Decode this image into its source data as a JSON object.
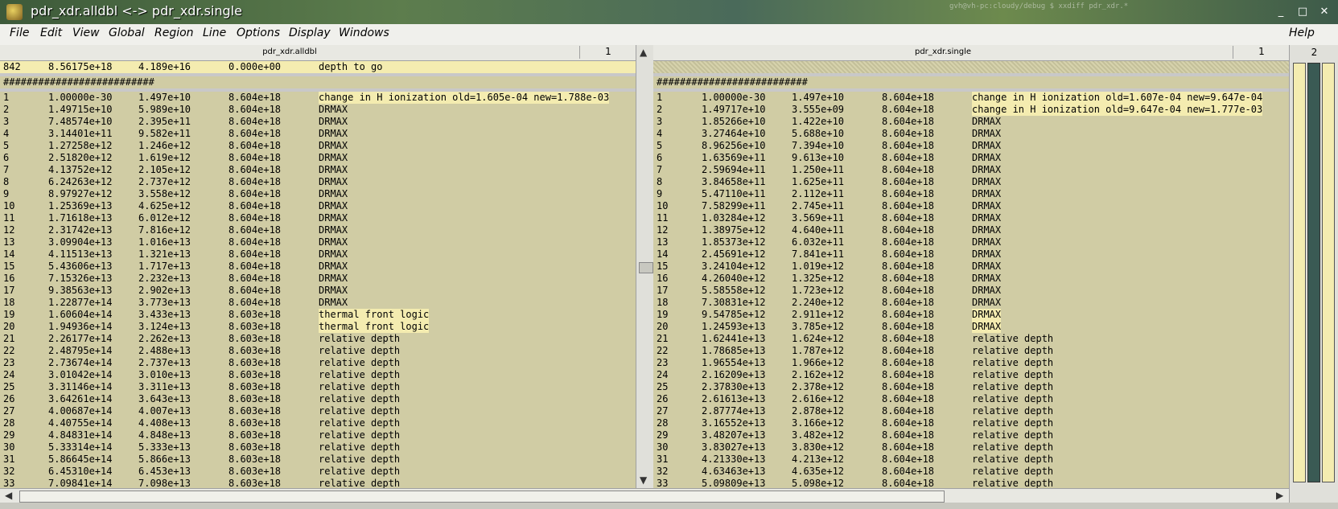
{
  "window": {
    "title": "pdr_xdr.alldbl <-> pdr_xdr.single",
    "bg_hint": "gvh@vh-pc:cloudy/debug $ xxdiff pdr_xdr.*",
    "minimize": "_",
    "maximize": "□",
    "close": "✕"
  },
  "menu": {
    "items": [
      "File",
      "Edit",
      "View",
      "Global",
      "Region",
      "Line",
      "Options",
      "Display",
      "Windows"
    ],
    "help": "Help"
  },
  "left": {
    "filename": "pdr_xdr.alldbl",
    "line": "1",
    "first": [
      "842",
      "8.56175e+18",
      "4.189e+16",
      "0.000e+00",
      "depth to go"
    ],
    "hashes": "##########################",
    "rows": [
      [
        "1",
        "1.00000e-30",
        "1.497e+10",
        "8.604e+18",
        "change in H ionization old=1.605e-04 new=1.788e-03"
      ],
      [
        "2",
        "1.49715e+10",
        "5.989e+10",
        "8.604e+18",
        "DRMAX"
      ],
      [
        "3",
        "7.48574e+10",
        "2.395e+11",
        "8.604e+18",
        "DRMAX"
      ],
      [
        "4",
        "3.14401e+11",
        "9.582e+11",
        "8.604e+18",
        "DRMAX"
      ],
      [
        "5",
        "1.27258e+12",
        "1.246e+12",
        "8.604e+18",
        "DRMAX"
      ],
      [
        "6",
        "2.51820e+12",
        "1.619e+12",
        "8.604e+18",
        "DRMAX"
      ],
      [
        "7",
        "4.13752e+12",
        "2.105e+12",
        "8.604e+18",
        "DRMAX"
      ],
      [
        "8",
        "6.24263e+12",
        "2.737e+12",
        "8.604e+18",
        "DRMAX"
      ],
      [
        "9",
        "8.97927e+12",
        "3.558e+12",
        "8.604e+18",
        "DRMAX"
      ],
      [
        "10",
        "1.25369e+13",
        "4.625e+12",
        "8.604e+18",
        "DRMAX"
      ],
      [
        "11",
        "1.71618e+13",
        "6.012e+12",
        "8.604e+18",
        "DRMAX"
      ],
      [
        "12",
        "2.31742e+13",
        "7.816e+12",
        "8.604e+18",
        "DRMAX"
      ],
      [
        "13",
        "3.09904e+13",
        "1.016e+13",
        "8.604e+18",
        "DRMAX"
      ],
      [
        "14",
        "4.11513e+13",
        "1.321e+13",
        "8.604e+18",
        "DRMAX"
      ],
      [
        "15",
        "5.43606e+13",
        "1.717e+13",
        "8.604e+18",
        "DRMAX"
      ],
      [
        "16",
        "7.15326e+13",
        "2.232e+13",
        "8.604e+18",
        "DRMAX"
      ],
      [
        "17",
        "9.38563e+13",
        "2.902e+13",
        "8.604e+18",
        "DRMAX"
      ],
      [
        "18",
        "1.22877e+14",
        "3.773e+13",
        "8.604e+18",
        "DRMAX"
      ],
      [
        "19",
        "1.60604e+14",
        "3.433e+13",
        "8.603e+18",
        "thermal front logic"
      ],
      [
        "20",
        "1.94936e+14",
        "3.124e+13",
        "8.603e+18",
        "thermal front logic"
      ],
      [
        "21",
        "2.26177e+14",
        "2.262e+13",
        "8.603e+18",
        "relative depth"
      ],
      [
        "22",
        "2.48795e+14",
        "2.488e+13",
        "8.603e+18",
        "relative depth"
      ],
      [
        "23",
        "2.73674e+14",
        "2.737e+13",
        "8.603e+18",
        "relative depth"
      ],
      [
        "24",
        "3.01042e+14",
        "3.010e+13",
        "8.603e+18",
        "relative depth"
      ],
      [
        "25",
        "3.31146e+14",
        "3.311e+13",
        "8.603e+18",
        "relative depth"
      ],
      [
        "26",
        "3.64261e+14",
        "3.643e+13",
        "8.603e+18",
        "relative depth"
      ],
      [
        "27",
        "4.00687e+14",
        "4.007e+13",
        "8.603e+18",
        "relative depth"
      ],
      [
        "28",
        "4.40755e+14",
        "4.408e+13",
        "8.603e+18",
        "relative depth"
      ],
      [
        "29",
        "4.84831e+14",
        "4.848e+13",
        "8.603e+18",
        "relative depth"
      ],
      [
        "30",
        "5.33314e+14",
        "5.333e+13",
        "8.603e+18",
        "relative depth"
      ],
      [
        "31",
        "5.86645e+14",
        "5.866e+13",
        "8.603e+18",
        "relative depth"
      ],
      [
        "32",
        "6.45310e+14",
        "6.453e+13",
        "8.603e+18",
        "relative depth"
      ],
      [
        "33",
        "7.09841e+14",
        "7.098e+13",
        "8.603e+18",
        "relative depth"
      ]
    ]
  },
  "right": {
    "filename": "pdr_xdr.single",
    "line": "1",
    "hashes": "##########################",
    "rows": [
      [
        "1",
        "1.00000e-30",
        "1.497e+10",
        "8.604e+18",
        "change in H ionization old=1.607e-04 new=9.647e-04"
      ],
      [
        "2",
        "1.49717e+10",
        "3.555e+09",
        "8.604e+18",
        "change in H ionization old=9.647e-04 new=1.777e-03"
      ],
      [
        "3",
        "1.85266e+10",
        "1.422e+10",
        "8.604e+18",
        "DRMAX"
      ],
      [
        "4",
        "3.27464e+10",
        "5.688e+10",
        "8.604e+18",
        "DRMAX"
      ],
      [
        "5",
        "8.96256e+10",
        "7.394e+10",
        "8.604e+18",
        "DRMAX"
      ],
      [
        "6",
        "1.63569e+11",
        "9.613e+10",
        "8.604e+18",
        "DRMAX"
      ],
      [
        "7",
        "2.59694e+11",
        "1.250e+11",
        "8.604e+18",
        "DRMAX"
      ],
      [
        "8",
        "3.84658e+11",
        "1.625e+11",
        "8.604e+18",
        "DRMAX"
      ],
      [
        "9",
        "5.47110e+11",
        "2.112e+11",
        "8.604e+18",
        "DRMAX"
      ],
      [
        "10",
        "7.58299e+11",
        "2.745e+11",
        "8.604e+18",
        "DRMAX"
      ],
      [
        "11",
        "1.03284e+12",
        "3.569e+11",
        "8.604e+18",
        "DRMAX"
      ],
      [
        "12",
        "1.38975e+12",
        "4.640e+11",
        "8.604e+18",
        "DRMAX"
      ],
      [
        "13",
        "1.85373e+12",
        "6.032e+11",
        "8.604e+18",
        "DRMAX"
      ],
      [
        "14",
        "2.45691e+12",
        "7.841e+11",
        "8.604e+18",
        "DRMAX"
      ],
      [
        "15",
        "3.24104e+12",
        "1.019e+12",
        "8.604e+18",
        "DRMAX"
      ],
      [
        "16",
        "4.26040e+12",
        "1.325e+12",
        "8.604e+18",
        "DRMAX"
      ],
      [
        "17",
        "5.58558e+12",
        "1.723e+12",
        "8.604e+18",
        "DRMAX"
      ],
      [
        "18",
        "7.30831e+12",
        "2.240e+12",
        "8.604e+18",
        "DRMAX"
      ],
      [
        "19",
        "9.54785e+12",
        "2.911e+12",
        "8.604e+18",
        "DRMAX"
      ],
      [
        "20",
        "1.24593e+13",
        "3.785e+12",
        "8.604e+18",
        "DRMAX"
      ],
      [
        "21",
        "1.62441e+13",
        "1.624e+12",
        "8.604e+18",
        "relative depth"
      ],
      [
        "22",
        "1.78685e+13",
        "1.787e+12",
        "8.604e+18",
        "relative depth"
      ],
      [
        "23",
        "1.96554e+13",
        "1.966e+12",
        "8.604e+18",
        "relative depth"
      ],
      [
        "24",
        "2.16209e+13",
        "2.162e+12",
        "8.604e+18",
        "relative depth"
      ],
      [
        "25",
        "2.37830e+13",
        "2.378e+12",
        "8.604e+18",
        "relative depth"
      ],
      [
        "26",
        "2.61613e+13",
        "2.616e+12",
        "8.604e+18",
        "relative depth"
      ],
      [
        "27",
        "2.87774e+13",
        "2.878e+12",
        "8.604e+18",
        "relative depth"
      ],
      [
        "28",
        "3.16552e+13",
        "3.166e+12",
        "8.604e+18",
        "relative depth"
      ],
      [
        "29",
        "3.48207e+13",
        "3.482e+12",
        "8.604e+18",
        "relative depth"
      ],
      [
        "30",
        "3.83027e+13",
        "3.830e+12",
        "8.604e+18",
        "relative depth"
      ],
      [
        "31",
        "4.21330e+13",
        "4.213e+12",
        "8.604e+18",
        "relative depth"
      ],
      [
        "32",
        "4.63463e+13",
        "4.635e+12",
        "8.604e+18",
        "relative depth"
      ],
      [
        "33",
        "5.09809e+13",
        "5.098e+12",
        "8.604e+18",
        "relative depth"
      ]
    ]
  },
  "overview": {
    "line": "2"
  },
  "colors": {
    "diff_bg": "#d0cca4",
    "diff_highlight": "#f4ecb0"
  }
}
